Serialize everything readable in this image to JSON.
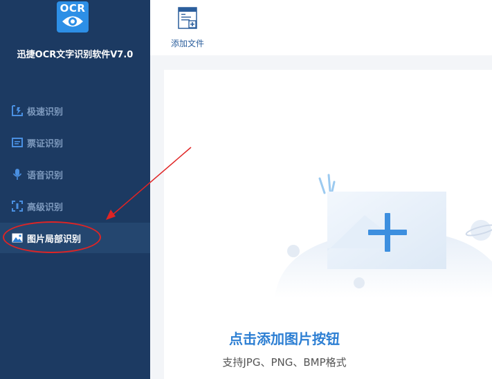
{
  "app": {
    "logo_text": "OCR",
    "title": "迅捷OCR文字识别软件V7.0"
  },
  "sidebar": {
    "items": [
      {
        "label": "极速识别",
        "icon": "fast-scan-icon",
        "active": false
      },
      {
        "label": "票证识别",
        "icon": "ticket-icon",
        "active": false
      },
      {
        "label": "语音识别",
        "icon": "microphone-icon",
        "active": false
      },
      {
        "label": "高级识别",
        "icon": "scan-frame-icon",
        "active": false
      },
      {
        "label": "图片局部识别",
        "icon": "image-icon",
        "active": true
      }
    ]
  },
  "toolbar": {
    "add_file_label": "添加文件",
    "add_file_icon": "add-file-icon"
  },
  "dropzone": {
    "title": "点击添加图片按钮",
    "subtitle": "支持JPG、PNG、BMP格式",
    "icon": "add-image-icon"
  },
  "annotation": {
    "color": "#e02424"
  },
  "colors": {
    "sidebar": "#1c3a62",
    "accent": "#2d7fd3"
  }
}
